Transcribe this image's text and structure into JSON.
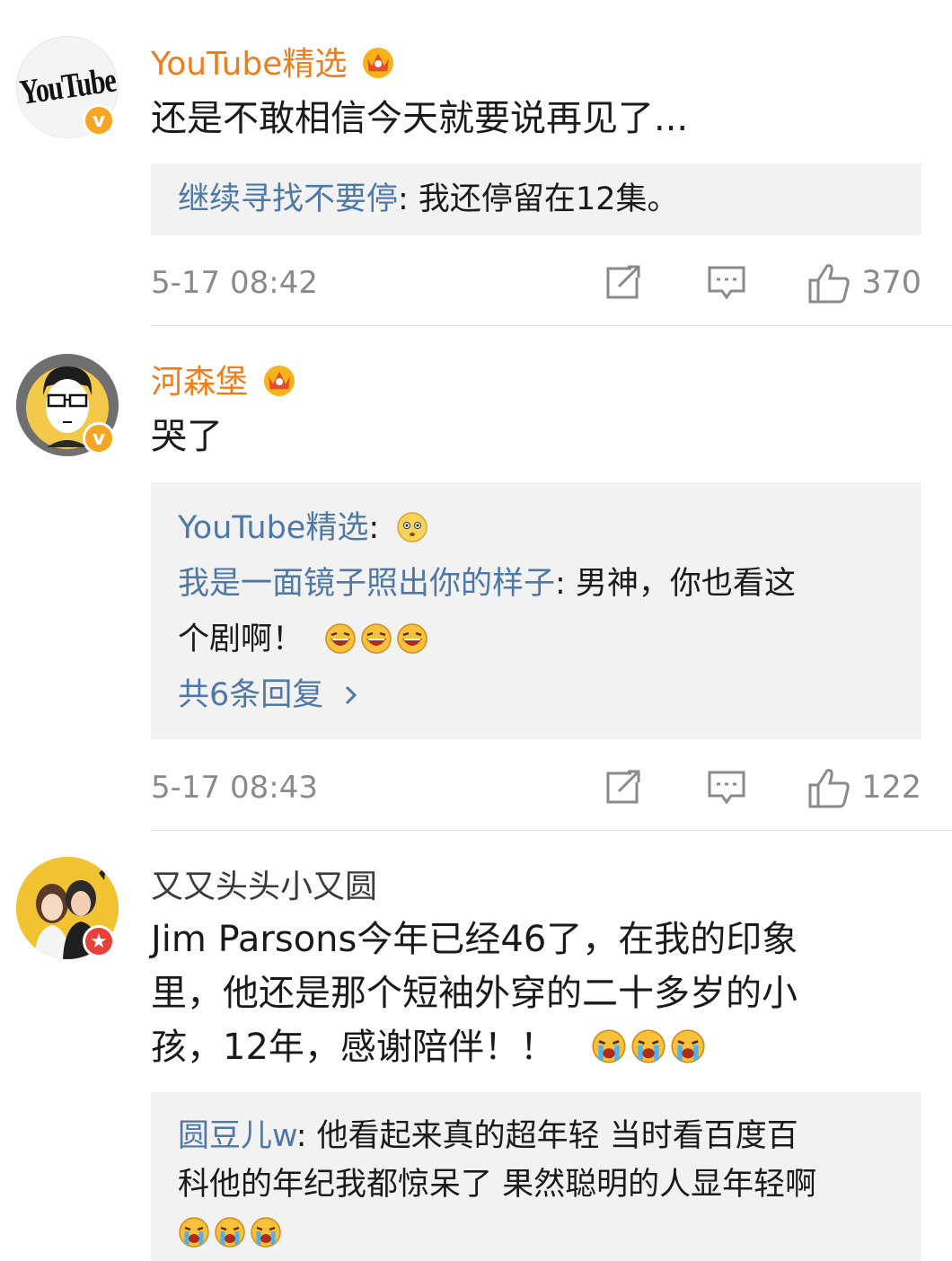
{
  "comments": [
    {
      "username": "YouTube精选",
      "avatar_label": "YouTube",
      "text": "还是不敢相信今天就要说再见了...",
      "reply_name": "继续寻找不要停",
      "reply_text": ": 我还停留在12集。",
      "time": "5-17 08:42",
      "likes": "370"
    },
    {
      "username": "河森堡",
      "text": "哭了",
      "reply1_name": "YouTube精选",
      "reply1_sep": ":",
      "reply2_name": "我是一面镜子照出你的样子",
      "reply2_text_a": ": 男神，你也看这",
      "reply2_text_b": "个剧啊！",
      "more_replies": "共6条回复",
      "time": "5-17 08:43",
      "likes": "122"
    },
    {
      "username": "又又头头小又圆",
      "text_line1": "Jim Parsons今年已经46了，在我的印象",
      "text_line2": "里，他还是那个短袖外穿的二十多岁的小",
      "text_line3": "孩，12年，感谢陪伴！！",
      "reply_name": "圆豆儿w",
      "reply_line1": ": 他看起来真的超年轻 当时看百度百",
      "reply_line2": "科他的年纪我都惊呆了 果然聪明的人显年轻啊"
    }
  ],
  "colors": {
    "username_vip": "#f07d18",
    "reply_name": "#4f78a8",
    "meta_gray": "#8a8a8a",
    "reply_bg": "#f2f2f2"
  }
}
